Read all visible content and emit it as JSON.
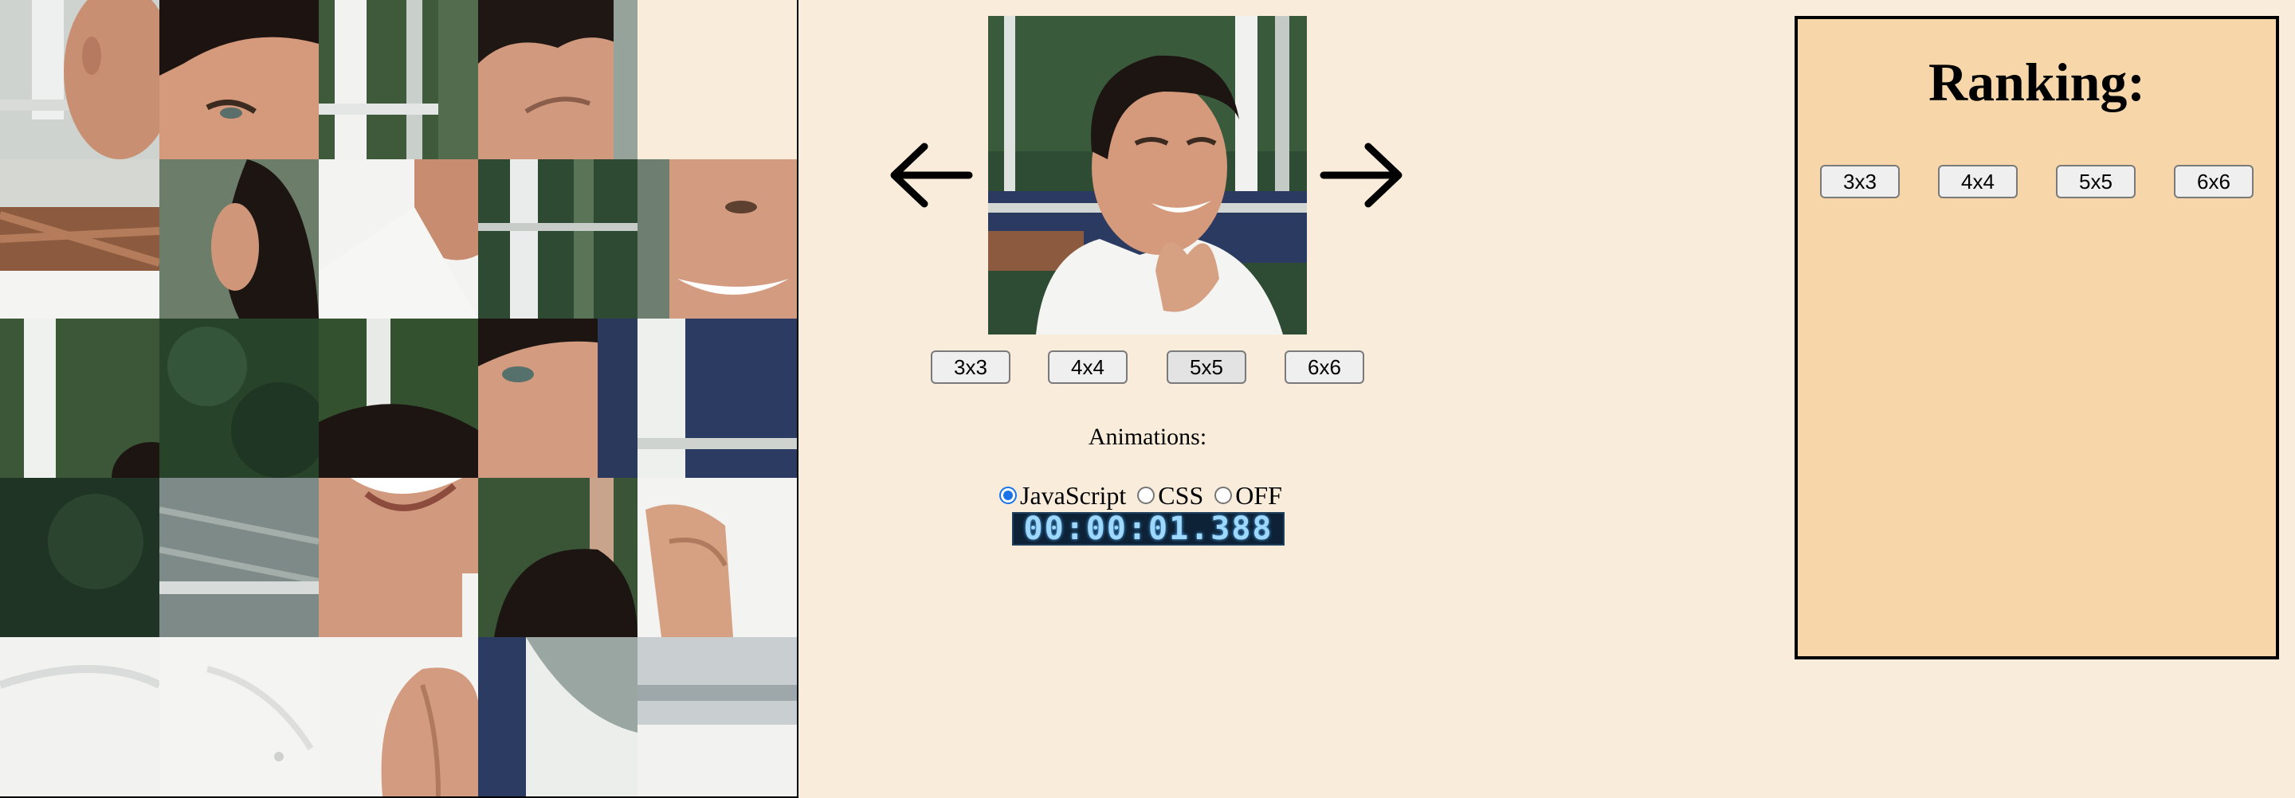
{
  "preview": {
    "arrow_left_icon": "arrow-left-icon",
    "arrow_right_icon": "arrow-right-icon"
  },
  "size_buttons": [
    "3x3",
    "4x4",
    "5x5",
    "6x6"
  ],
  "selected_size": "5x5",
  "animations": {
    "title": "Animations:",
    "options": [
      "JavaScript",
      "CSS",
      "OFF"
    ],
    "selected": "JavaScript"
  },
  "timer": "00:00:01.388",
  "ranking": {
    "title": "Ranking:",
    "buttons": [
      "3x3",
      "4x4",
      "5x5",
      "6x6"
    ]
  },
  "colors": {
    "page_background": "#f9ecdb",
    "ranking_background": "#f7d6aa",
    "timer_background": "#0d2236",
    "timer_digits": "#9fd8ff",
    "radio_accent": "#1a73e8"
  }
}
